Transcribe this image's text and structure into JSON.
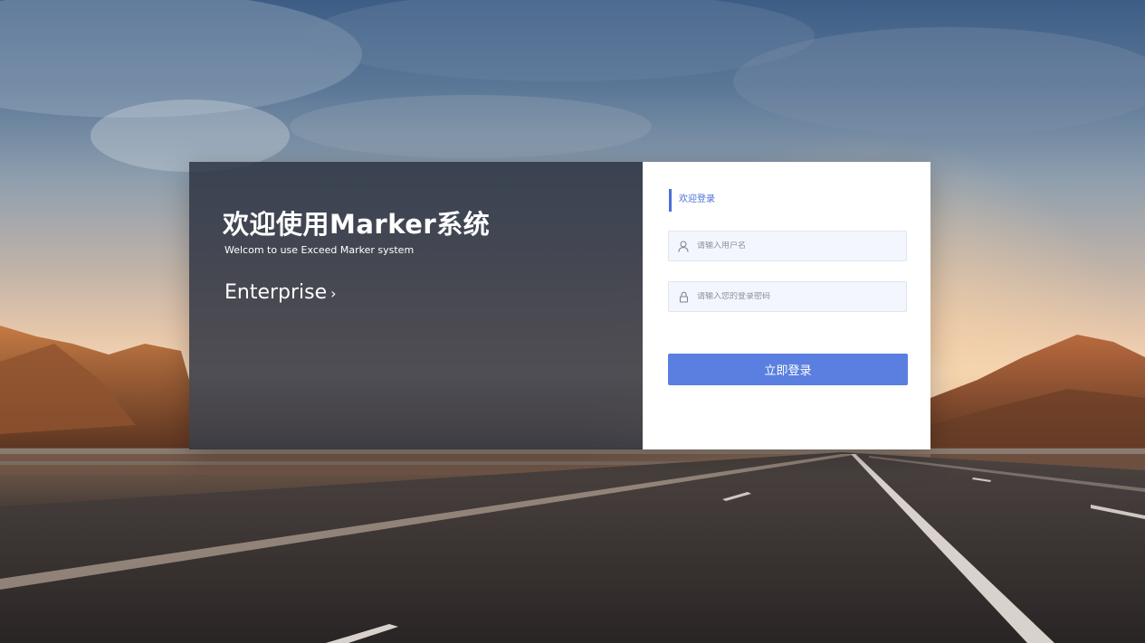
{
  "intro": {
    "title": "欢迎使用Marker系统",
    "subtitle": "Welcom to use Exceed Marker system",
    "edition": "Enterprise",
    "edition_chevron": "›"
  },
  "login": {
    "heading": "欢迎登录",
    "username_placeholder": "请输入用户名",
    "password_placeholder": "请输入您的登录密码",
    "submit_label": "立即登录"
  },
  "colors": {
    "accent": "#5b7fe0",
    "heading_accent": "#4a6fd8",
    "panel_dark": "#2a2f3e",
    "input_bg": "#f3f7fd"
  },
  "icons": {
    "username": "user-icon",
    "password": "lock-icon",
    "edition": "chevron-right-icon"
  }
}
